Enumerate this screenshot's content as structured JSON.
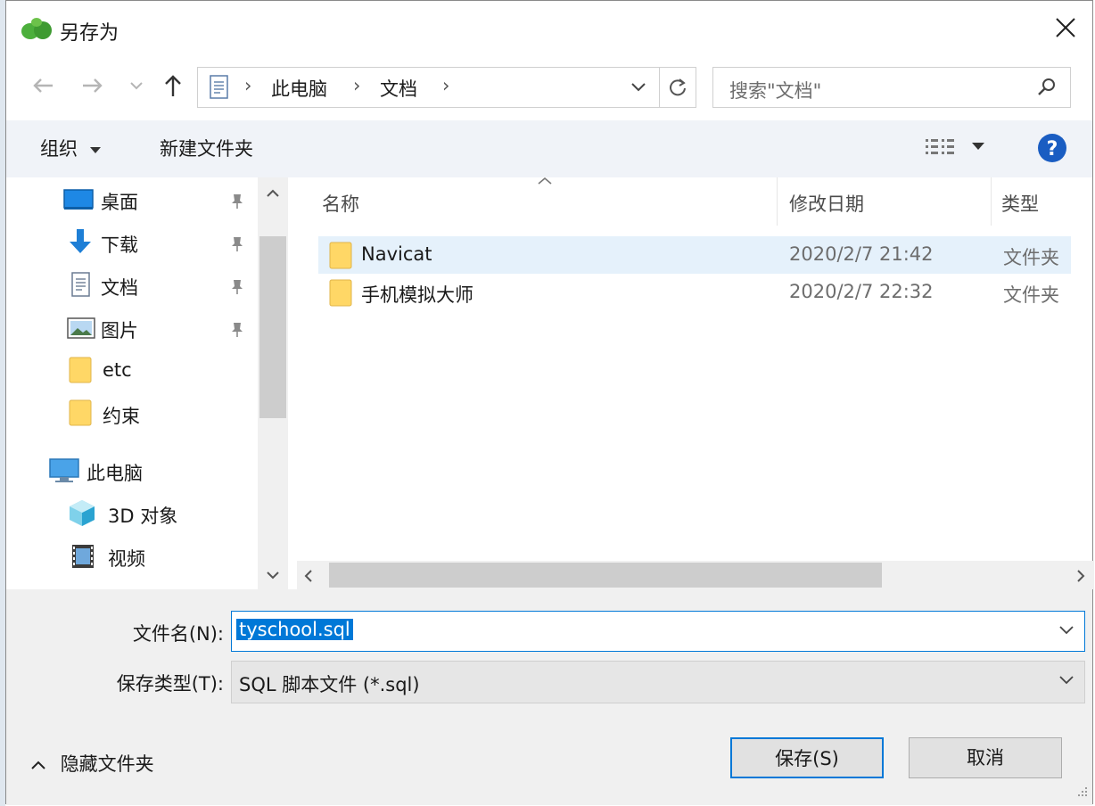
{
  "window": {
    "title": "另存为",
    "close_label": "×"
  },
  "navigation": {
    "breadcrumb": [
      "此电脑",
      "文档"
    ],
    "search_placeholder": "搜索\"文档\""
  },
  "toolbar": {
    "organize_label": "组织",
    "new_folder_label": "新建文件夹"
  },
  "sidebar": {
    "quick_access": [
      {
        "label": "桌面",
        "icon": "desktop-icon",
        "pinned": true
      },
      {
        "label": "下载",
        "icon": "download-icon",
        "pinned": true
      },
      {
        "label": "文档",
        "icon": "document-icon",
        "pinned": true
      },
      {
        "label": "图片",
        "icon": "picture-icon",
        "pinned": true
      },
      {
        "label": "etc",
        "icon": "folder-icon",
        "pinned": false
      },
      {
        "label": "约束",
        "icon": "folder-icon",
        "pinned": false
      }
    ],
    "this_pc": {
      "label": "此电脑",
      "icon": "computer-icon"
    },
    "this_pc_items": [
      {
        "label": "3D 对象",
        "icon": "3d-objects-icon"
      },
      {
        "label": "视频",
        "icon": "video-icon"
      }
    ]
  },
  "file_list": {
    "columns": [
      "名称",
      "修改日期",
      "类型"
    ],
    "rows": [
      {
        "name": "Navicat",
        "modified": "2020/2/7 21:42",
        "type": "文件夹"
      },
      {
        "name": "手机模拟大师",
        "modified": "2020/2/7 22:32",
        "type": "文件夹"
      }
    ]
  },
  "form": {
    "filename_label": "文件名(N):",
    "filename_value": "tyschool.sql",
    "filetype_label": "保存类型(T):",
    "filetype_value": "SQL 脚本文件 (*.sql)"
  },
  "footer": {
    "hide_folders_label": "隐藏文件夹",
    "save_label": "保存(S)",
    "cancel_label": "取消"
  },
  "colors": {
    "accent": "#0078d7",
    "selected_row": "#e5f1fb",
    "toolbar_bg": "#f0f3f8",
    "folder": "#ffd766"
  }
}
